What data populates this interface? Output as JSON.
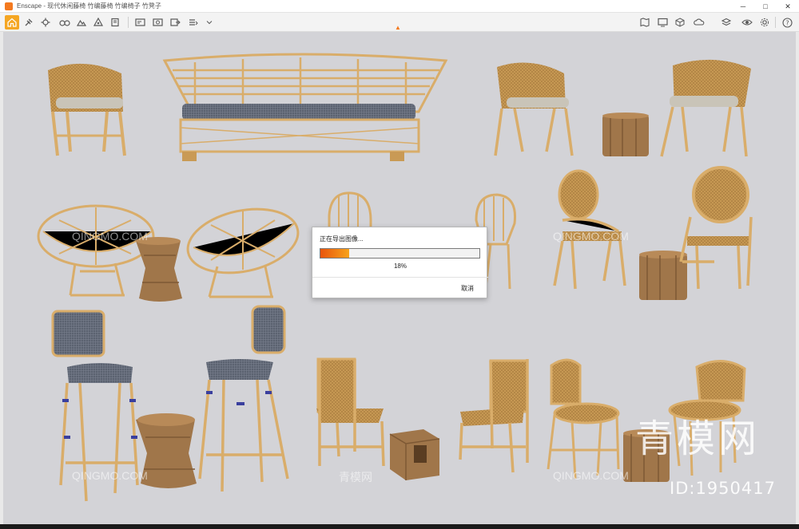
{
  "window": {
    "title": "Enscape - 现代休闲藤椅 竹编藤椅 竹编椅子 竹凳子",
    "controls": {
      "minimize": "─",
      "maximize": "□",
      "close": "✕"
    }
  },
  "toolbar": {
    "icons": [
      "home-icon",
      "plugin-icon",
      "settings-icon",
      "binoculars-icon",
      "mountain-icon",
      "light-icon",
      "book-icon",
      "view-icon",
      "capture-icon",
      "export-icon",
      "batch-icon",
      "panorama-icon",
      "upload-icon",
      "map-icon",
      "monitor-icon",
      "cube-icon",
      "cloud-icon",
      "layers-icon",
      "eye-icon",
      "gear-icon",
      "help-icon"
    ],
    "accent_color": "#f5a623"
  },
  "dialog": {
    "title": "正在导出图像...",
    "progress_percent": 18,
    "progress_label": "18%",
    "cancel_label": "取消"
  },
  "watermarks": {
    "site_latin": "QINGMO.COM",
    "site_cn": "青模网",
    "brand_cn": "青模网",
    "brand_id": "ID:1950417"
  },
  "scene": {
    "background_color": "#d3d3d7",
    "rattan_color": "#d9ad6a",
    "cushion_color": "#5b6270",
    "wood_color": "#a0764a"
  }
}
